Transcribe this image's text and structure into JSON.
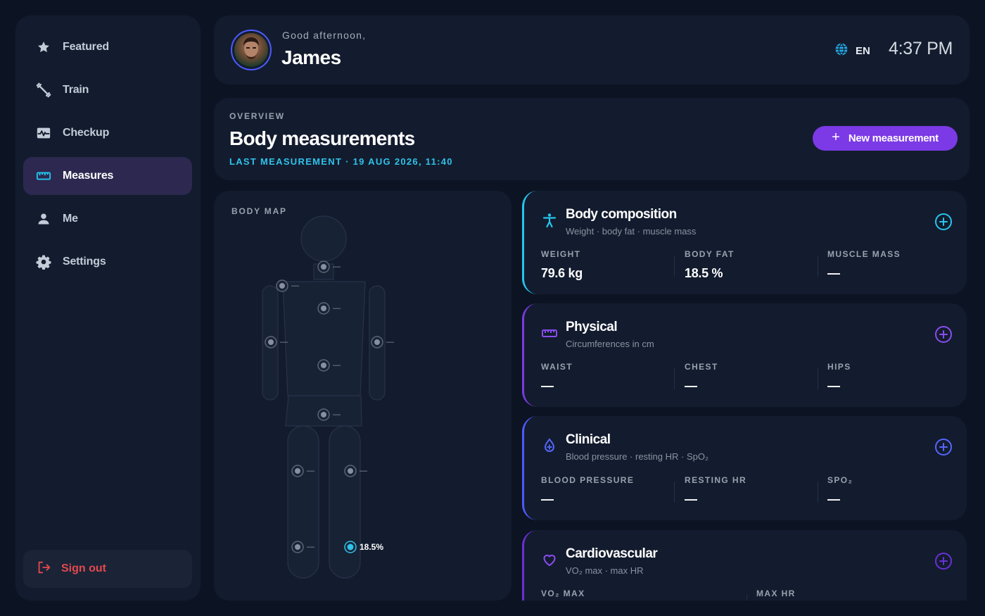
{
  "sidebar": {
    "items": [
      {
        "label": "Featured"
      },
      {
        "label": "Train"
      },
      {
        "label": "Checkup"
      },
      {
        "label": "Measures"
      },
      {
        "label": "Me"
      },
      {
        "label": "Settings"
      }
    ],
    "signout_label": "Sign out"
  },
  "header": {
    "greeting": "Good afternoon,",
    "user_name": "James",
    "language": "EN",
    "time": "4:37 PM"
  },
  "overview": {
    "eyebrow": "OVERVIEW",
    "title": "Body measurements",
    "last_measurement": "LAST MEASUREMENT · 19 AUG 2026, 11:40",
    "new_button_label": "New measurement"
  },
  "body_map": {
    "title": "BODY MAP",
    "empty_value": "—",
    "active_value": "18.5%"
  },
  "cards": [
    {
      "title": "Body composition",
      "subtitle": "Weight · body fat · muscle mass",
      "accent": "#25c6ee",
      "metrics": [
        {
          "label": "WEIGHT",
          "value": "79.6 kg"
        },
        {
          "label": "BODY FAT",
          "value": "18.5 %"
        },
        {
          "label": "MUSCLE MASS",
          "value": "—"
        }
      ]
    },
    {
      "title": "Physical",
      "subtitle": "Circumferences in cm",
      "accent": "#7b3ae6",
      "metrics": [
        {
          "label": "WAIST",
          "value": "—"
        },
        {
          "label": "CHEST",
          "value": "—"
        },
        {
          "label": "HIPS",
          "value": "—"
        }
      ]
    },
    {
      "title": "Clinical",
      "subtitle": "Blood pressure · resting HR · SpO₂",
      "accent": "#4d5bff",
      "metrics": [
        {
          "label": "BLOOD PRESSURE",
          "value": "—"
        },
        {
          "label": "RESTING HR",
          "value": "—"
        },
        {
          "label": "SPO₂",
          "value": "—"
        }
      ]
    },
    {
      "title": "Cardiovascular",
      "subtitle": "VO₂ max · max HR",
      "accent": "#6a2fd8",
      "metrics": [
        {
          "label": "VO₂ MAX",
          "value": "—"
        },
        {
          "label": "MAX HR",
          "value": "—"
        }
      ]
    }
  ],
  "colors": {
    "background": "#0c1423",
    "panel": "#131c2e",
    "primary": "#7b3ae6",
    "cyan": "#2fc2ea",
    "danger": "#e4484f"
  }
}
